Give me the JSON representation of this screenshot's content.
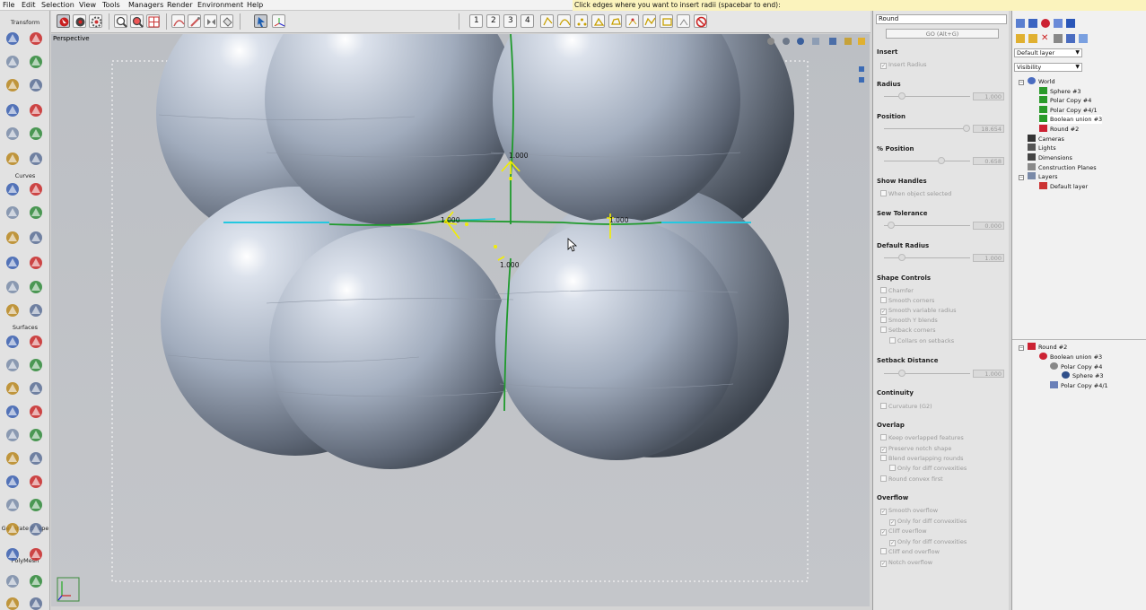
{
  "menubar": {
    "items": [
      "File",
      "Edit",
      "Selection",
      "View",
      "Tools",
      "Managers",
      "Render",
      "Environment",
      "Help"
    ]
  },
  "prompt": "Click edges where you want to insert radii (spacebar to end):",
  "toolbar": {
    "view_buttons": [
      "1",
      "2",
      "3",
      "4"
    ]
  },
  "left_panel": {
    "sections": [
      "Transform",
      "Curves",
      "Surfaces",
      "Generate Shape",
      "PolyMesh"
    ]
  },
  "viewport": {
    "label": "Perspective",
    "radius_labels": [
      "1.000",
      "1.000",
      "1.000",
      "1.000"
    ],
    "colors": {
      "selected_edge": "#24c8e0",
      "round_edge": "#1f9a2c",
      "handle": "#f2ee00"
    }
  },
  "properties": {
    "search_value": "Round",
    "go_button": "GO (Alt+G)",
    "sections": {
      "insert": "Insert",
      "radius": "Radius",
      "position": "Position",
      "pct_position": "% Position",
      "show_handles": "Show Handles",
      "sew_tolerance": "Sew Tolerance",
      "default_radius": "Default Radius",
      "shape_controls": "Shape Controls",
      "setback_distance": "Setback Distance",
      "continuity": "Continuity",
      "overlap": "Overlap",
      "overflow": "Overflow"
    },
    "insert_radius": "Insert Radius",
    "radius_value": "1.000",
    "position_value": "18.654",
    "pct_position_value": "0.658",
    "when_object_selected": "When object selected",
    "sew_tolerance_value": "0.000",
    "default_radius_value": "1.000",
    "shape_controls": [
      "Chamfer",
      "Smooth corners",
      "Smooth variable radius",
      "Smooth Y blends",
      "Setback corners",
      "Collars on setbacks"
    ],
    "setback_value": "1.000",
    "continuity_option": "Curvature (G2)",
    "overlap_options": [
      "Keep overlapped features",
      "Preserve notch shape",
      "Blend overlapping rounds",
      "Only for diff convexities",
      "Round convex first"
    ],
    "overflow_options": [
      "Smooth overflow",
      "Only for diff convexities",
      "Cliff overflow",
      "Only for diff convexities",
      "Cliff end overflow",
      "Notch overflow"
    ]
  },
  "tree": {
    "layer_dropdown": "Default layer",
    "visibility_dropdown": "Visibility",
    "world": "World",
    "world_children": [
      "Sphere #3",
      "Polar Copy #4",
      "Polar Copy #4/1",
      "Boolean union #3",
      "Round #2"
    ],
    "other_roots": [
      "Cameras",
      "Lights",
      "Dimensions",
      "Construction Planes",
      "Layers"
    ],
    "layer_child": "Default layer",
    "history": [
      "Round #2",
      "Boolean union #3",
      "Polar Copy #4",
      "Sphere #3",
      "Polar Copy #4/1"
    ]
  }
}
